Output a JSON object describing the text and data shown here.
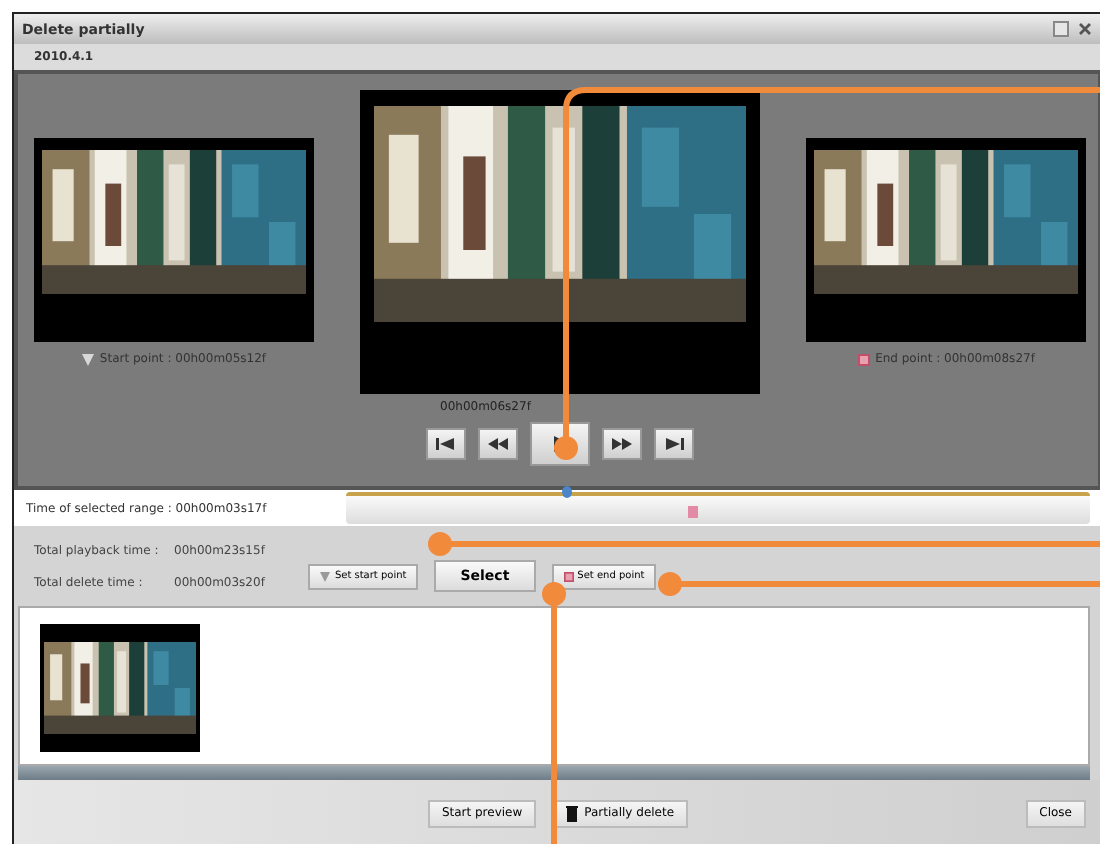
{
  "window": {
    "title": "Delete partially"
  },
  "tabs": [
    {
      "label": "2010.4.1",
      "selected": true
    }
  ],
  "previews": {
    "start_label": "Start point : 00h00m05s12f",
    "current_time": "00h00m06s27f",
    "end_label": "End point : 00h00m08s27f"
  },
  "transport": [
    {
      "kind": "first"
    },
    {
      "kind": "prev"
    },
    {
      "kind": "play"
    },
    {
      "kind": "next"
    },
    {
      "kind": "last"
    }
  ],
  "range": {
    "label": "Time of selected range : 00h00m03s17f",
    "start_handle": {
      "level": 0.29
    },
    "end_handle": {
      "level": 0.46
    }
  },
  "totals": [
    {
      "label": "Total playback time :",
      "value": "00h00m23s15f"
    },
    {
      "label": "Total delete time :",
      "value": "00h00m03s20f"
    }
  ],
  "edit_buttons": [
    {
      "kind": "start",
      "label": "Set start point"
    },
    {
      "kind": "plain",
      "label": "Select"
    },
    {
      "kind": "end",
      "label": "Set end point"
    }
  ],
  "footer_buttons": [
    {
      "kind": "plain",
      "label": "Start preview"
    },
    {
      "kind": "delete",
      "label": "Partially delete"
    },
    {
      "kind": "plain",
      "label": "Close"
    }
  ]
}
